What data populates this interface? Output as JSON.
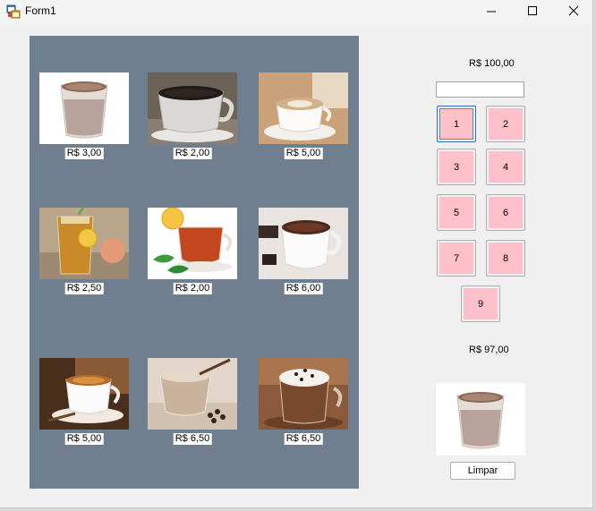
{
  "window": {
    "title": "Form1",
    "app_icon": "winforms-app-icon",
    "controls": [
      "minimize-icon",
      "maximize-icon",
      "close-icon"
    ]
  },
  "products": [
    {
      "price": "R$ 3,00",
      "image": "hot-chocolate-glass"
    },
    {
      "price": "R$ 2,00",
      "image": "black-coffee-cup"
    },
    {
      "price": "R$ 5,00",
      "image": "cappuccino-cup"
    },
    {
      "price": "R$ 2,50",
      "image": "iced-tea-glass"
    },
    {
      "price": "R$ 2,00",
      "image": "tea-cup-lemon-mint"
    },
    {
      "price": "R$ 6,00",
      "image": "hot-chocolate-mug"
    },
    {
      "price": "R$ 5,00",
      "image": "espresso-cup"
    },
    {
      "price": "R$ 6,50",
      "image": "iced-latte-glass"
    },
    {
      "price": "R$ 6,50",
      "image": "mocha-whipped-cream-glass"
    }
  ],
  "balance": "R$ 100,00",
  "code_input": {
    "value": ""
  },
  "keypad": [
    "1",
    "2",
    "3",
    "4",
    "5",
    "6",
    "7",
    "8",
    "9"
  ],
  "remaining": "R$ 97,00",
  "selected_image": "hot-chocolate-glass",
  "clear_label": "Limpar",
  "colors": {
    "panel_bg": "#6f7f8f",
    "key_bg": "#ffc0cb",
    "window_bg": "#f0f0f0"
  }
}
